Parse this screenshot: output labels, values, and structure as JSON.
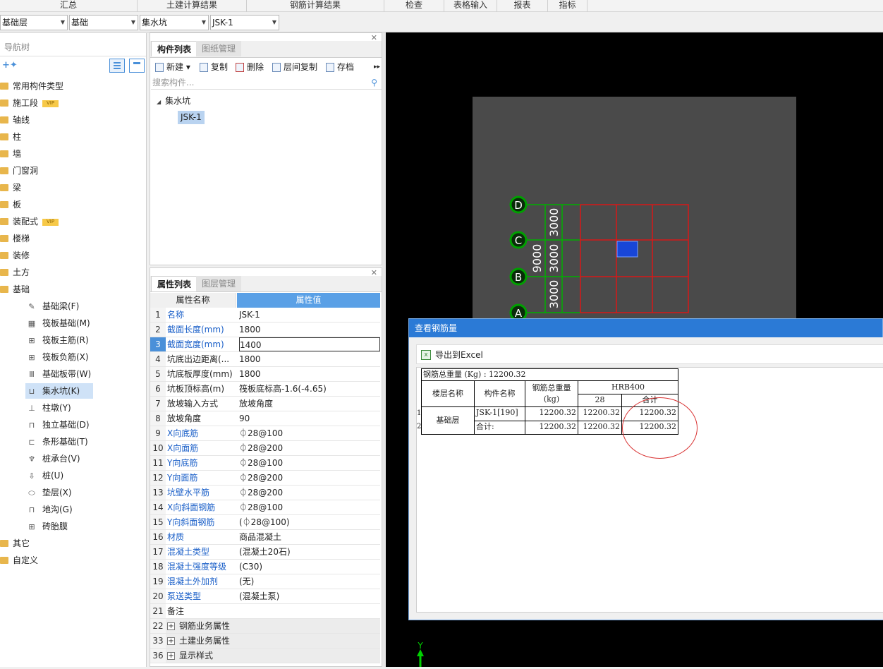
{
  "top_menu": [
    "汇总",
    "土建计算结果",
    "钢筋计算结果",
    "检查",
    "表格输入",
    "报表",
    "指标"
  ],
  "selectors": [
    "基础层",
    "基础",
    "集水坑",
    "JSK-1"
  ],
  "nav": {
    "title": "导航树",
    "vip": "VIP",
    "categories": [
      "常用构件类型",
      "施工段",
      "轴线",
      "柱",
      "墙",
      "门窗洞",
      "梁",
      "板",
      "装配式",
      "楼梯",
      "装修",
      "土方",
      "基础"
    ],
    "sub_items": [
      "基础梁(F)",
      "筏板基础(M)",
      "筏板主筋(R)",
      "筏板负筋(X)",
      "基础板带(W)",
      "集水坑(K)",
      "柱墩(Y)",
      "独立基础(D)",
      "条形基础(T)",
      "桩承台(V)",
      "桩(U)",
      "垫层(X)",
      "地沟(G)",
      "砖胎膜"
    ],
    "tail": [
      "其它",
      "自定义"
    ]
  },
  "component_panel": {
    "tabs": [
      "构件列表",
      "图纸管理"
    ],
    "toolbar": [
      "新建",
      "复制",
      "删除",
      "层间复制",
      "存档"
    ],
    "search_placeholder": "搜索构件...",
    "tree_root": "集水坑",
    "tree_child": "JSK-1"
  },
  "property_panel": {
    "tabs": [
      "属性列表",
      "图层管理"
    ],
    "header": [
      "属性名称",
      "属性值"
    ],
    "rows": [
      {
        "n": "1",
        "k": "名称",
        "v": "JSK-1"
      },
      {
        "n": "2",
        "k": "截面长度(mm)",
        "v": "1800"
      },
      {
        "n": "3",
        "k": "截面宽度(mm)",
        "v": "1400"
      },
      {
        "n": "4",
        "k": "坑底出边距离(...",
        "v": "1800"
      },
      {
        "n": "5",
        "k": "坑底板厚度(mm)",
        "v": "1800"
      },
      {
        "n": "6",
        "k": "坑板顶标高(m)",
        "v": "筏板底标高-1.6(-4.65)"
      },
      {
        "n": "7",
        "k": "放坡输入方式",
        "v": "放坡角度"
      },
      {
        "n": "8",
        "k": "放坡角度",
        "v": "90"
      },
      {
        "n": "9",
        "k": "X向底筋",
        "v": "⏀28@100"
      },
      {
        "n": "10",
        "k": "X向面筋",
        "v": "⏀28@200"
      },
      {
        "n": "11",
        "k": "Y向底筋",
        "v": "⏀28@100"
      },
      {
        "n": "12",
        "k": "Y向面筋",
        "v": "⏀28@200"
      },
      {
        "n": "13",
        "k": "坑壁水平筋",
        "v": "⏀28@200"
      },
      {
        "n": "14",
        "k": "X向斜面钢筋",
        "v": "⏀28@100"
      },
      {
        "n": "15",
        "k": "Y向斜面钢筋",
        "v": "(⏀28@100)"
      },
      {
        "n": "16",
        "k": "材质",
        "v": "商品混凝土"
      },
      {
        "n": "17",
        "k": "混凝土类型",
        "v": "(混凝土20石)"
      },
      {
        "n": "18",
        "k": "混凝土强度等级",
        "v": "(C30)"
      },
      {
        "n": "19",
        "k": "混凝土外加剂",
        "v": "(无)"
      },
      {
        "n": "20",
        "k": "泵送类型",
        "v": "(混凝土泵)"
      },
      {
        "n": "21",
        "k": "备注",
        "v": ""
      },
      {
        "n": "22",
        "k": "钢筋业务属性",
        "v": ""
      },
      {
        "n": "33",
        "k": "土建业务属性",
        "v": ""
      },
      {
        "n": "36",
        "k": "显示样式",
        "v": ""
      }
    ]
  },
  "canvas": {
    "axis_labels": [
      "D",
      "C",
      "B",
      "A"
    ],
    "dims": [
      "3000",
      "3000",
      "3000"
    ],
    "total_dim": "9000",
    "y_axis": "Y"
  },
  "dialog": {
    "title": "查看钢筋量",
    "export_label": "导出到Excel",
    "total_weight": "钢筋总重量 (Kg) : 12200.32",
    "col_floor": "楼层名称",
    "col_comp": "构件名称",
    "col_weight": "钢筋总重量(kg)",
    "col_grade": "HRB400",
    "col_d28": "28",
    "col_sum": "合计",
    "floor": "基础层",
    "row1": {
      "idx": "1",
      "comp": "JSK-1[190]",
      "w": "12200.32",
      "d28": "12200.32",
      "sum": "12200.32"
    },
    "row2": {
      "idx": "2",
      "comp": "合计:",
      "w": "12200.32",
      "d28": "12200.32",
      "sum": "12200.32"
    }
  }
}
